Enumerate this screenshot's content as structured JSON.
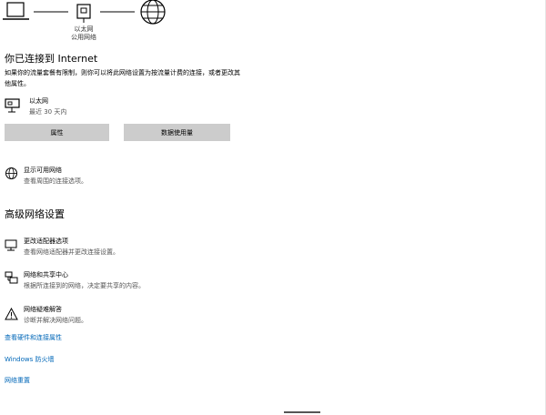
{
  "diagram": {
    "caption_line1": "以太网",
    "caption_line2": "公用网络"
  },
  "status": {
    "title": "你已连接到 Internet",
    "description": "如果你的流量套餐有限制，则你可以将此网络设置为按流量计费的连接，或者更改其他属性。"
  },
  "adapter": {
    "name": "以太网",
    "usage": "最近 30 天内"
  },
  "buttons": {
    "properties": "属性",
    "data_usage": "数据使用量"
  },
  "show_networks": {
    "title": "显示可用网络",
    "subtitle": "查看周围的连接选项。"
  },
  "advanced": {
    "heading": "高级网络设置",
    "items": [
      {
        "title": "更改适配器选项",
        "subtitle": "查看网络适配器并更改连接设置。"
      },
      {
        "title": "网络和共享中心",
        "subtitle": "根据所连接到的网络，决定要共享的内容。"
      },
      {
        "title": "网络疑难解答",
        "subtitle": "诊断并解决网络问题。"
      }
    ]
  },
  "links": {
    "hardware_props": "查看硬件和连接属性",
    "firewall": "Windows 防火墙",
    "reset": "网络重置"
  },
  "colors": {
    "link": "#0067b8",
    "button_bg": "#cccccc"
  }
}
